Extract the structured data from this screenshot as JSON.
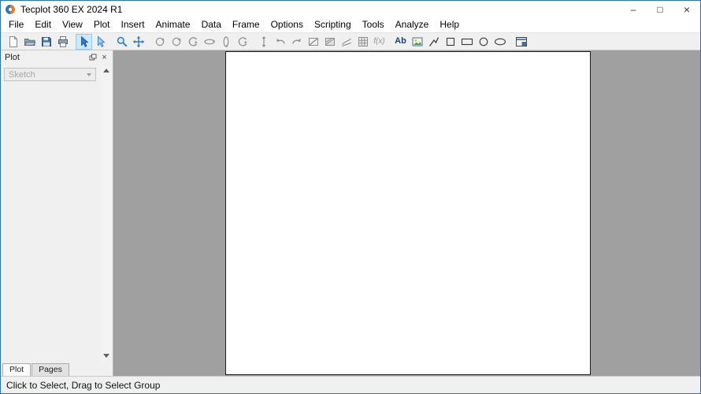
{
  "colors": {
    "accent_border": "#2b6fb5",
    "workspace_bg": "#a0a0a0",
    "chrome_bg": "#f0f0f0",
    "selected_tool_bg": "#cde8ff",
    "selected_tool_border": "#98c6ec",
    "canvas_bg": "#ffffff",
    "disabled_icon": "#8f8f8f",
    "enabled_icon_blue": "#2f78c8"
  },
  "window": {
    "title": "Tecplot 360 EX 2024 R1",
    "controls": {
      "minimize": "–",
      "maximize": "□",
      "close": "×"
    }
  },
  "menu": {
    "items": [
      "File",
      "Edit",
      "View",
      "Plot",
      "Insert",
      "Animate",
      "Data",
      "Frame",
      "Options",
      "Scripting",
      "Tools",
      "Analyze",
      "Help"
    ]
  },
  "toolbar": {
    "items": [
      {
        "name": "new-layout-button",
        "icon": "new-page",
        "state": "normal"
      },
      {
        "name": "open-button",
        "icon": "open-folder",
        "state": "normal"
      },
      {
        "name": "save-button",
        "icon": "floppy",
        "state": "normal"
      },
      {
        "name": "print-button",
        "icon": "printer",
        "state": "normal"
      },
      {
        "type": "sep"
      },
      {
        "name": "select-tool",
        "icon": "select-arrow",
        "state": "selected"
      },
      {
        "name": "adjust-tool",
        "icon": "adjust-arrow",
        "state": "normal"
      },
      {
        "type": "sep"
      },
      {
        "name": "zoom-tool",
        "icon": "magnifier",
        "state": "normal"
      },
      {
        "name": "translate-tool",
        "icon": "move-arrows",
        "state": "normal"
      },
      {
        "type": "sep"
      },
      {
        "name": "rotate-spherical-tool",
        "icon": "rotate-sphere",
        "state": "disabled"
      },
      {
        "name": "rotate-rollerball-tool",
        "icon": "rotate-sphere",
        "state": "disabled"
      },
      {
        "name": "rotate-twist-tool",
        "icon": "rotate-twist",
        "state": "disabled"
      },
      {
        "name": "rotate-x-tool",
        "icon": "rotate-horizontal",
        "state": "disabled"
      },
      {
        "name": "rotate-y-tool",
        "icon": "rotate-vertical",
        "state": "disabled"
      },
      {
        "name": "rotate-z-tool",
        "icon": "rotate-twist",
        "state": "disabled"
      },
      {
        "type": "sep"
      },
      {
        "name": "probe-tool",
        "icon": "probe",
        "state": "disabled"
      },
      {
        "name": "undo-button",
        "icon": "undo",
        "state": "disabled"
      },
      {
        "name": "redo-button",
        "icon": "redo",
        "state": "disabled"
      },
      {
        "name": "slice-tool",
        "icon": "slice",
        "state": "disabled"
      },
      {
        "name": "contour-tool",
        "icon": "contour",
        "state": "disabled"
      },
      {
        "name": "streamtrace-tool",
        "icon": "streamtrace",
        "state": "disabled"
      },
      {
        "name": "data-spreadsheet-tool",
        "icon": "grid",
        "state": "disabled"
      },
      {
        "name": "equations-tool",
        "icon": "fx-text",
        "state": "disabled",
        "label": "f(x)"
      },
      {
        "type": "sep"
      },
      {
        "name": "add-text-tool",
        "icon": "ab-text",
        "state": "normal",
        "label": "Ab"
      },
      {
        "name": "add-image-tool",
        "icon": "picture",
        "state": "normal"
      },
      {
        "name": "add-polyline-tool",
        "icon": "polyline",
        "state": "normal"
      },
      {
        "name": "add-square-tool",
        "icon": "square",
        "state": "normal"
      },
      {
        "name": "add-rectangle-tool",
        "icon": "rectangle",
        "state": "normal"
      },
      {
        "name": "add-circle-tool",
        "icon": "circle",
        "state": "normal"
      },
      {
        "name": "add-ellipse-tool",
        "icon": "ellipse",
        "state": "normal"
      },
      {
        "type": "sep"
      },
      {
        "name": "create-frame-tool",
        "icon": "frame-window",
        "state": "normal"
      }
    ]
  },
  "sidebar": {
    "title": "Plot",
    "close_glyph": "×",
    "dropdown_value": "Sketch",
    "dropdown_disabled": true,
    "tabs": [
      {
        "label": "Plot",
        "active": true
      },
      {
        "label": "Pages",
        "active": false
      }
    ]
  },
  "statusbar": {
    "text": "Click to Select, Drag to Select Group"
  }
}
